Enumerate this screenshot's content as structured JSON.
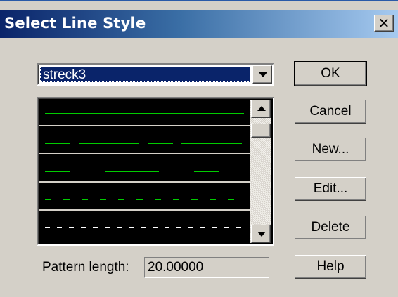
{
  "window": {
    "title": "Select Line Style",
    "close_glyph": "✕"
  },
  "style_select": {
    "selected": "streck3"
  },
  "line_styles": [
    {
      "name": "solid",
      "color": "#00cc00",
      "dash": "none"
    },
    {
      "name": "long-dash",
      "color": "#00cc00",
      "dash": "36 12 86 12"
    },
    {
      "name": "dash-gap",
      "color": "#00cc00",
      "dash": "36 50 76 50"
    },
    {
      "name": "dashed",
      "color": "#00cc00",
      "dash": "9 17"
    },
    {
      "name": "dotted",
      "color": "#ffffff",
      "dash": "7 10"
    }
  ],
  "pattern_length": {
    "label": "Pattern length:",
    "value": "20.00000"
  },
  "buttons": {
    "ok": "OK",
    "cancel": "Cancel",
    "new": "New...",
    "edit": "Edit...",
    "delete": "Delete",
    "help": "Help"
  },
  "colors": {
    "titlebar_start": "#0a246a",
    "face": "#d4d0c8",
    "selection": "#0a246a"
  }
}
